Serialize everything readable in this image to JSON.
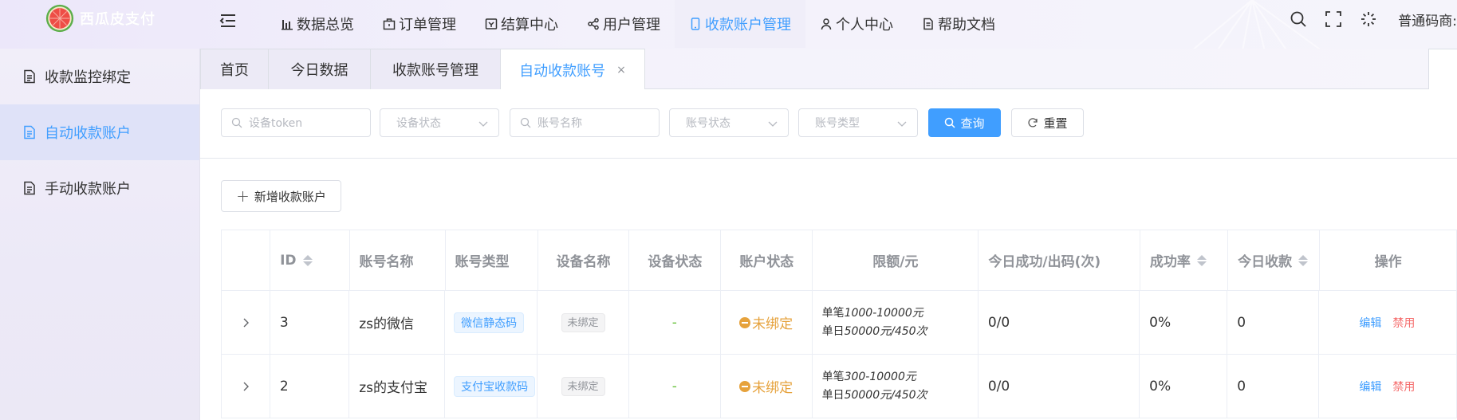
{
  "app": {
    "name": "西瓜皮支付"
  },
  "nav": [
    {
      "label": "数据总览",
      "icon": "bar-chart-icon"
    },
    {
      "label": "订单管理",
      "icon": "briefcase-icon"
    },
    {
      "label": "结算中心",
      "icon": "settlement-icon"
    },
    {
      "label": "用户管理",
      "icon": "share-icon"
    },
    {
      "label": "收款账户管理",
      "icon": "phone-icon",
      "active": true
    },
    {
      "label": "个人中心",
      "icon": "user-icon"
    },
    {
      "label": "帮助文档",
      "icon": "document-icon"
    }
  ],
  "header_user": "普通码商:",
  "sidebar": [
    {
      "label": "收款监控绑定"
    },
    {
      "label": "自动收款账户",
      "active": true
    },
    {
      "label": "手动收款账户"
    }
  ],
  "tabs": [
    {
      "label": "首页"
    },
    {
      "label": "今日数据"
    },
    {
      "label": "收款账号管理"
    },
    {
      "label": "自动收款账号",
      "active": true,
      "close": "×"
    }
  ],
  "filters": {
    "device_token_placeholder": "设备token",
    "device_status_placeholder": "设备状态",
    "account_name_placeholder": "账号名称",
    "account_status_placeholder": "账号状态",
    "account_type_placeholder": "账号类型",
    "query_label": "查询",
    "reset_label": "重置"
  },
  "add_button": "新增收款账户",
  "table": {
    "columns": [
      "ID",
      "账号名称",
      "账号类型",
      "设备名称",
      "设备状态",
      "账户状态",
      "限额/元",
      "今日成功/出码(次)",
      "成功率",
      "今日收款",
      "操作"
    ],
    "rows": [
      {
        "id": "3",
        "name": "zs的微信",
        "type": "微信静态码",
        "device": "未绑定",
        "device_status": "-",
        "account_status": "未绑定",
        "limit_single_prefix": "单笔",
        "limit_single": "1000-10000元",
        "limit_daily_prefix": "单日",
        "limit_daily": "50000元/450次",
        "success_out": "0/0",
        "rate": "0%",
        "today": "0",
        "edit": "编辑",
        "disable": "禁用"
      },
      {
        "id": "2",
        "name": "zs的支付宝",
        "type": "支付宝收款码",
        "device": "未绑定",
        "device_status": "-",
        "account_status": "未绑定",
        "limit_single_prefix": "单笔",
        "limit_single": "300-10000元",
        "limit_daily_prefix": "单日",
        "limit_daily": "50000元/450次",
        "success_out": "0/0",
        "rate": "0%",
        "today": "0",
        "edit": "编辑",
        "disable": "禁用"
      }
    ]
  },
  "colors": {
    "primary": "#409eff",
    "warning": "#e6a23c",
    "danger": "#f56c6c",
    "success": "#67c23a"
  }
}
